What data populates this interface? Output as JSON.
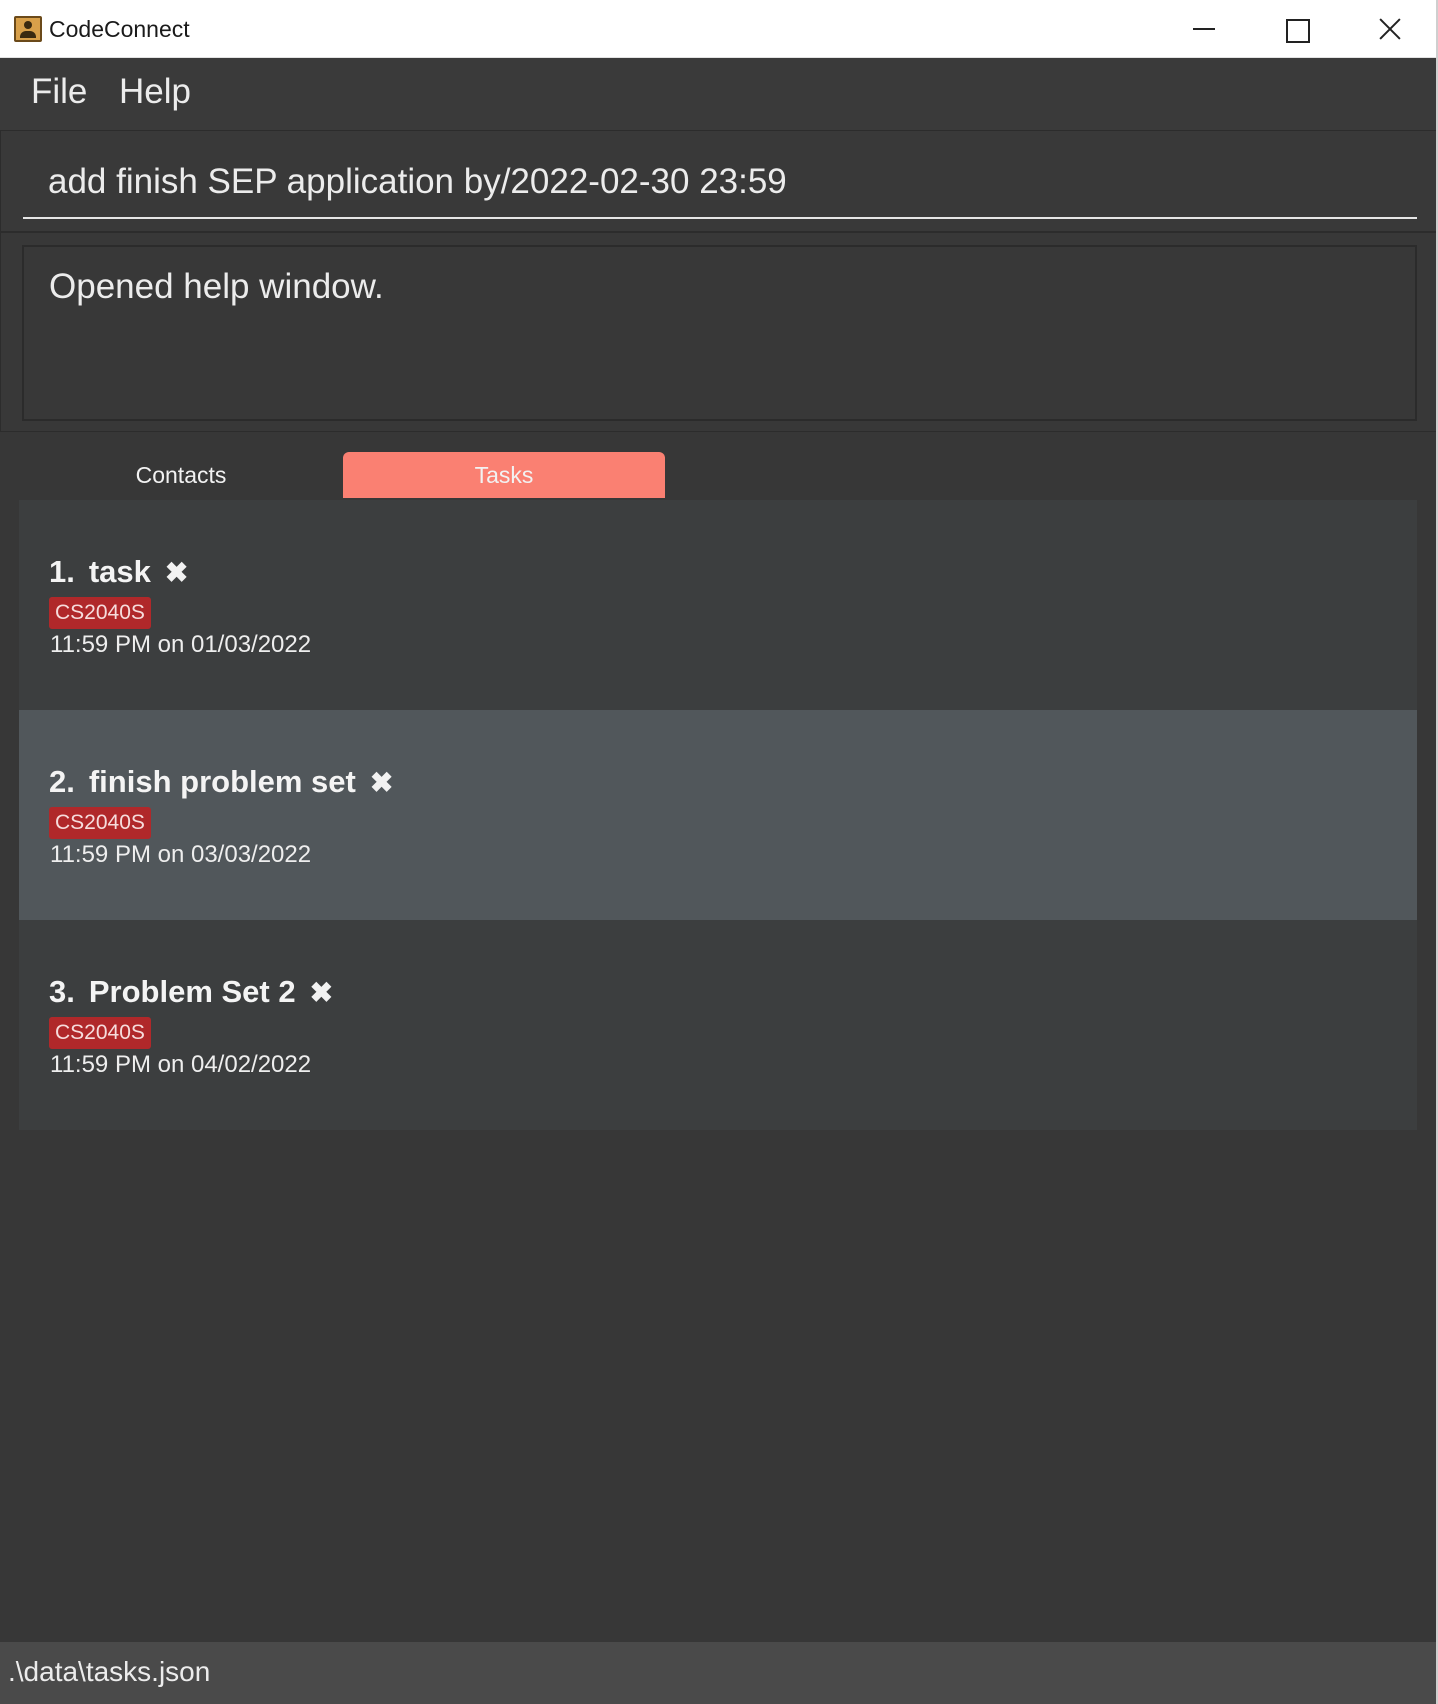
{
  "window": {
    "title": "CodeConnect",
    "app_icon": "address-book-icon"
  },
  "menu": {
    "file_label": "File",
    "help_label": "Help"
  },
  "command": {
    "value": "add finish SEP application by/2022-02-30 23:59"
  },
  "result": {
    "message": "Opened help window."
  },
  "tabs": {
    "contacts_label": "Contacts",
    "tasks_label": "Tasks",
    "active": "Tasks"
  },
  "tasks": [
    {
      "index": "1.",
      "title": "task",
      "tag": "CS2040S",
      "due": "11:59 PM on 01/03/2022",
      "close": "✖"
    },
    {
      "index": "2.",
      "title": "finish problem set",
      "tag": "CS2040S",
      "due": "11:59 PM on 03/03/2022",
      "close": "✖"
    },
    {
      "index": "3.",
      "title": "Problem Set 2",
      "tag": "CS2040S",
      "due": "11:59 PM on 04/02/2022",
      "close": "✖"
    }
  ],
  "status": {
    "path": ".\\data\\tasks.json"
  },
  "colors": {
    "background": "#373737",
    "active_tab": "#fa8072",
    "tag": "#b0282a",
    "selected_card": "#51575b"
  }
}
